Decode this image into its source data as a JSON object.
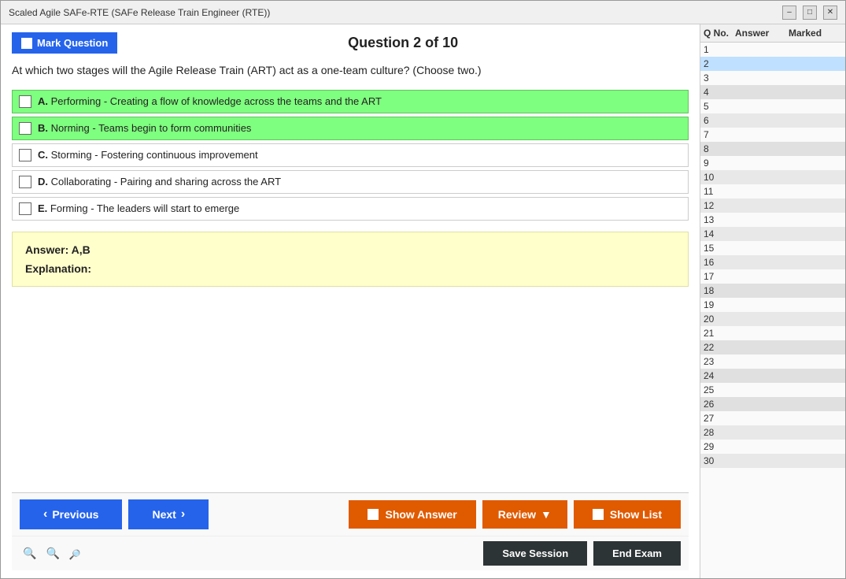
{
  "titleBar": {
    "title": "Scaled Agile SAFe-RTE (SAFe Release Train Engineer (RTE))",
    "minimizeLabel": "–",
    "maximizeLabel": "□",
    "closeLabel": "✕"
  },
  "header": {
    "markQuestionLabel": "Mark Question",
    "questionTitle": "Question 2 of 10"
  },
  "question": {
    "text": "At which two stages will the Agile Release Train (ART) act as a one-team culture? (Choose two.)",
    "options": [
      {
        "letter": "A",
        "text": "Performing - Creating a flow of knowledge across the teams and the ART",
        "correct": true
      },
      {
        "letter": "B",
        "text": "Norming - Teams begin to form communities",
        "correct": true
      },
      {
        "letter": "C",
        "text": "Storming - Fostering continuous improvement",
        "correct": false
      },
      {
        "letter": "D",
        "text": "Collaborating - Pairing and sharing across the ART",
        "correct": false
      },
      {
        "letter": "E",
        "text": "Forming - The leaders will start to emerge",
        "correct": false
      }
    ]
  },
  "answerBox": {
    "answerLabel": "Answer: A,B",
    "explanationLabel": "Explanation:"
  },
  "bottomBar": {
    "previousLabel": "Previous",
    "nextLabel": "Next",
    "showAnswerLabel": "Show Answer",
    "reviewLabel": "Review",
    "reviewArrow": "▼",
    "showListLabel": "Show List"
  },
  "zoomBar": {
    "zoomInLabel": "🔍",
    "zoomNormalLabel": "🔍",
    "zoomOutLabel": "🔍"
  },
  "sessionBar": {
    "saveSessionLabel": "Save Session",
    "endExamLabel": "End Exam"
  },
  "rightPanel": {
    "headers": {
      "qNo": "Q No.",
      "answer": "Answer",
      "marked": "Marked"
    },
    "questions": [
      {
        "num": 1
      },
      {
        "num": 2,
        "current": true
      },
      {
        "num": 3
      },
      {
        "num": 4,
        "alt": true
      },
      {
        "num": 5
      },
      {
        "num": 6
      },
      {
        "num": 7
      },
      {
        "num": 8,
        "alt": true
      },
      {
        "num": 9
      },
      {
        "num": 10
      },
      {
        "num": 11
      },
      {
        "num": 12
      },
      {
        "num": 13
      },
      {
        "num": 14
      },
      {
        "num": 15
      },
      {
        "num": 16
      },
      {
        "num": 17
      },
      {
        "num": 18,
        "alt": true
      },
      {
        "num": 19
      },
      {
        "num": 20
      },
      {
        "num": 21
      },
      {
        "num": 22,
        "alt": true
      },
      {
        "num": 23
      },
      {
        "num": 24,
        "alt": true
      },
      {
        "num": 25
      },
      {
        "num": 26,
        "alt": true
      },
      {
        "num": 27
      },
      {
        "num": 28
      },
      {
        "num": 29
      },
      {
        "num": 30
      }
    ]
  }
}
